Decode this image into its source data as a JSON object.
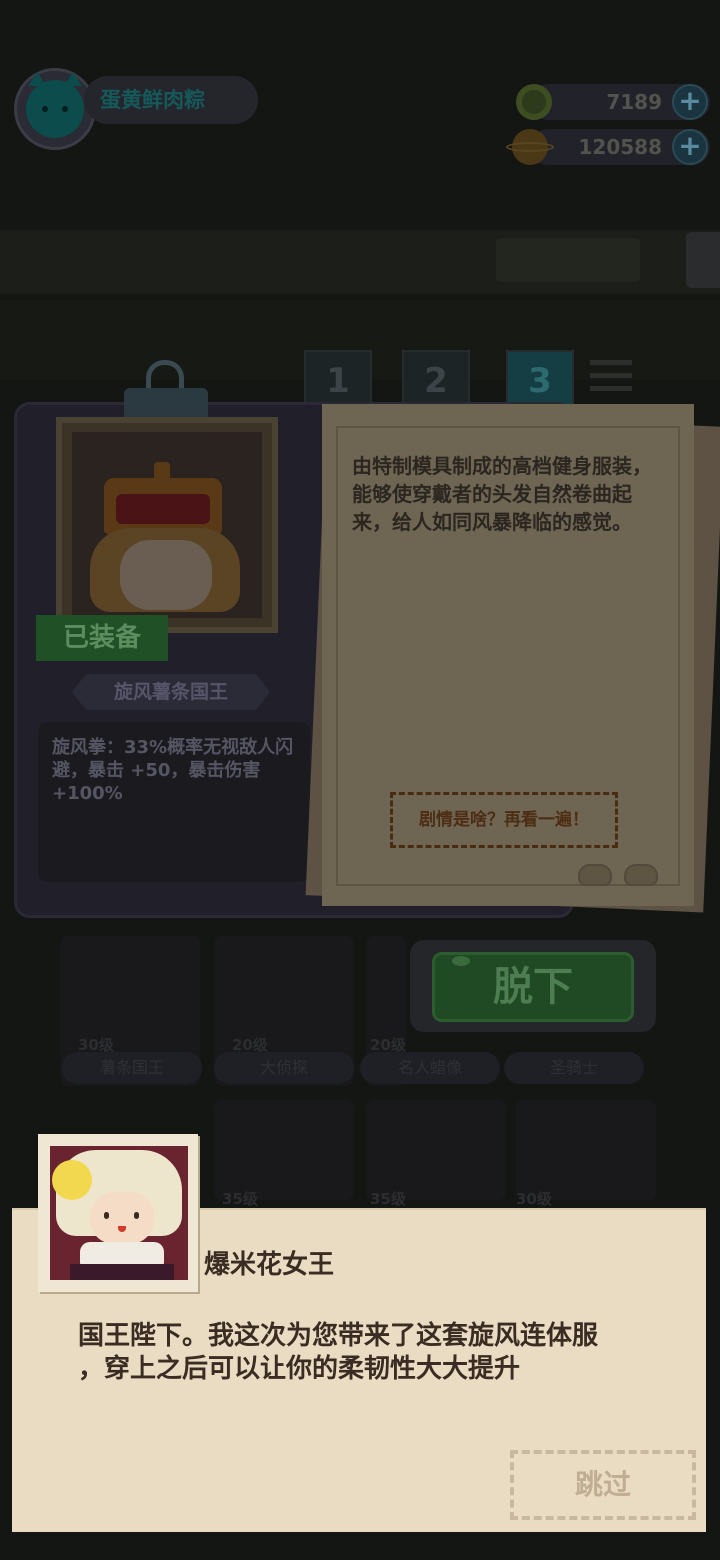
{
  "player": {
    "name": "蛋黄鲜肉粽",
    "avatar_icon": "cat-avatar-icon"
  },
  "currencies": [
    {
      "name": "donut",
      "icon": "donut-coin-icon",
      "value": "7189"
    },
    {
      "name": "planet",
      "icon": "planet-coin-icon",
      "value": "120588"
    }
  ],
  "tabs": [
    "1",
    "2",
    "3"
  ],
  "active_tab": "3",
  "outfit": {
    "status": "已装备",
    "name": "旋风薯条国王",
    "skill": "旋风拳：33%概率无视敌人闪避，暴击 +50，暴击伤害 +100%",
    "description": "由特制模具制成的高档健身服装，能够使穿戴者的头发自然卷曲起来，给人如同风暴降临的感觉。",
    "replay_label": "剧情是啥？再看一遍！",
    "unequip_label": "脱下"
  },
  "grid": [
    {
      "level": "30级",
      "name": "薯条国王"
    },
    {
      "level": "20级",
      "name": "大侦探"
    },
    {
      "level": "20级",
      "name": "名人蜡像"
    },
    {
      "level": "",
      "name": "圣骑士"
    },
    {
      "level": "35级",
      "name": ""
    },
    {
      "level": "35级",
      "name": ""
    },
    {
      "level": "30级",
      "name": ""
    }
  ],
  "dialog": {
    "speaker": "爆米花女王",
    "text_line1": "国王陛下。我这次为您带来了这套旋风连体服",
    "text_line2": "，穿上之后可以让你的柔韧性大大提升",
    "skip_label": "跳过"
  },
  "colors": {
    "accent_green": "#1f4a24",
    "paper": "#e9dcc3",
    "background": "#141613"
  }
}
